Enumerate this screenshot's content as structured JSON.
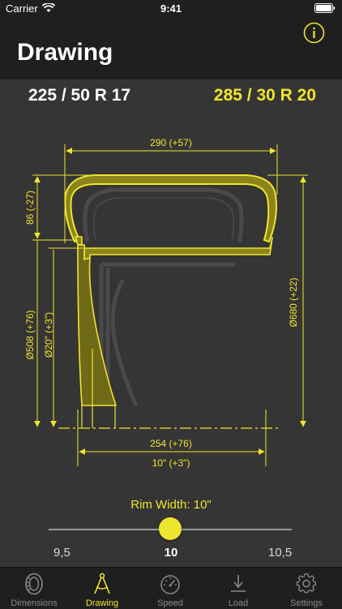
{
  "status_bar": {
    "carrier": "Carrier",
    "time": "9:41",
    "wifi_icon": "wifi-icon",
    "battery_icon": "battery-icon"
  },
  "header": {
    "title": "Drawing",
    "info_icon": "info-icon"
  },
  "tire_sizes": {
    "original": "225 / 50 R 17",
    "new": "285 / 30 R 20"
  },
  "dimensions": {
    "width": "290 (+57)",
    "sidewall": "86 (-27)",
    "overall_diameter": "Ø680 (+22)",
    "rim_diameter_mm": "Ø508 (+76)",
    "rim_diameter_in": "Ø20\" (+3\")",
    "rim_width_mm": "254 (+76)",
    "rim_width_in": "10\" (+3\")"
  },
  "rim_width": {
    "label": "Rim Width: 10\"",
    "min_label": "9,5",
    "current_label": "10",
    "max_label": "10,5",
    "slider_level": 0.5
  },
  "tabs": [
    {
      "label": "Dimensions",
      "icon": "tire-icon",
      "active": false
    },
    {
      "label": "Drawing",
      "icon": "compass-icon",
      "active": true
    },
    {
      "label": "Speed",
      "icon": "speedometer-icon",
      "active": false
    },
    {
      "label": "Load",
      "icon": "download-arrow-icon",
      "active": false
    },
    {
      "label": "Settings",
      "icon": "gear-icon",
      "active": false
    }
  ],
  "colors": {
    "accent": "#f0e52e",
    "background": "#353535",
    "bars": "#1f1f1f"
  }
}
